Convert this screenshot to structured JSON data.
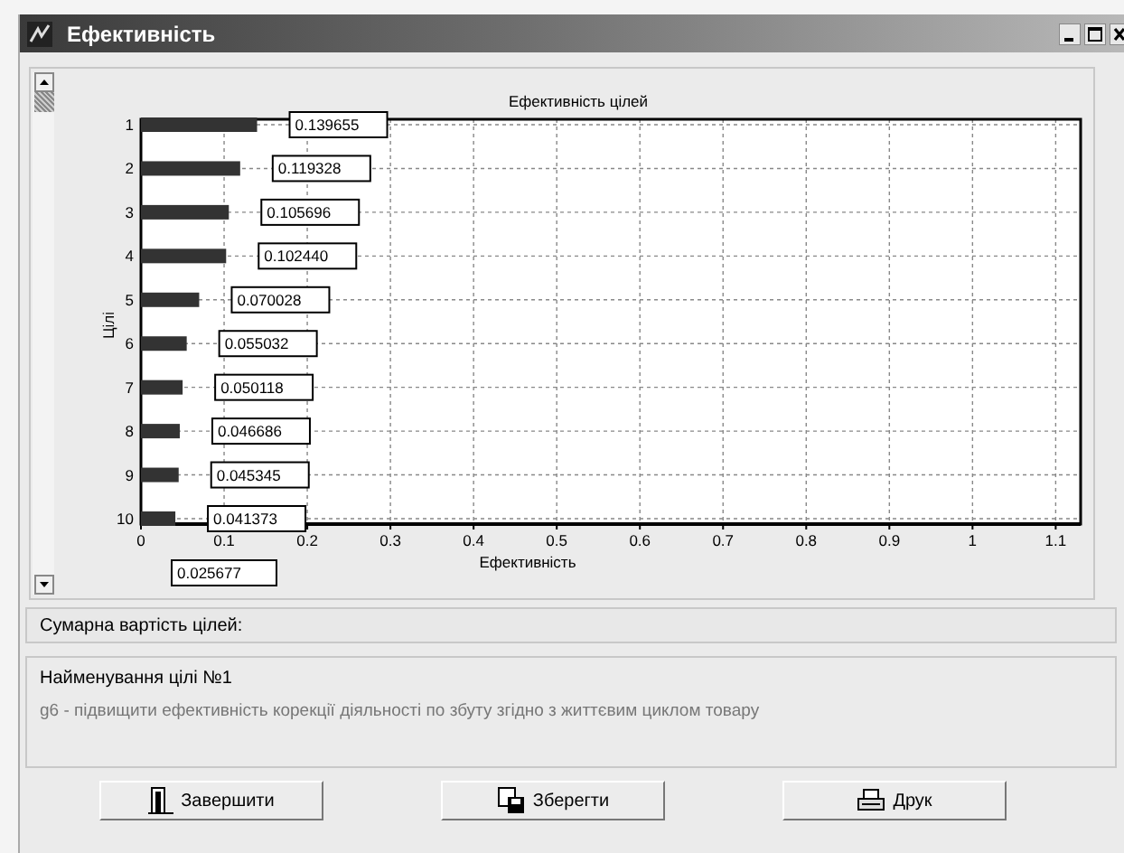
{
  "window": {
    "title": "Ефективність"
  },
  "chart": {
    "chart_data": {
      "type": "bar",
      "orientation": "horizontal",
      "title": "Ефективність цілей",
      "xlabel": "Ефективність",
      "ylabel": "Цілі",
      "categories": [
        "1",
        "2",
        "3",
        "4",
        "5",
        "6",
        "7",
        "8",
        "9",
        "10"
      ],
      "values": [
        0.139655,
        0.119328,
        0.105696,
        0.10244,
        0.070028,
        0.055032,
        0.050118,
        0.046686,
        0.045345,
        0.041373
      ],
      "value_labels": [
        "0.139655",
        "0.119328",
        "0.105696",
        "0.102440",
        "0.070028",
        "0.055032",
        "0.050118",
        "0.046686",
        "0.045345",
        "0.041373"
      ],
      "grid": true,
      "xlim": [
        0,
        1.13
      ],
      "xticks": [
        0,
        0.1,
        0.2,
        0.3,
        0.4,
        0.5,
        0.6,
        0.7,
        0.8,
        0.9,
        1,
        1.1
      ],
      "annotations": [
        "0.025677"
      ]
    }
  },
  "summary": {
    "label": "Сумарна вартість цілей:"
  },
  "goal": {
    "title": "Найменування цілі №1",
    "description": "g6 - підвищити ефективність корекції діяльності по збуту згідно з життєвим циклом товару"
  },
  "buttons": [
    {
      "label": "Завершити",
      "kind": "exit"
    },
    {
      "label": "Зберегти",
      "kind": "save"
    },
    {
      "label": "Друк",
      "kind": "print"
    }
  ]
}
